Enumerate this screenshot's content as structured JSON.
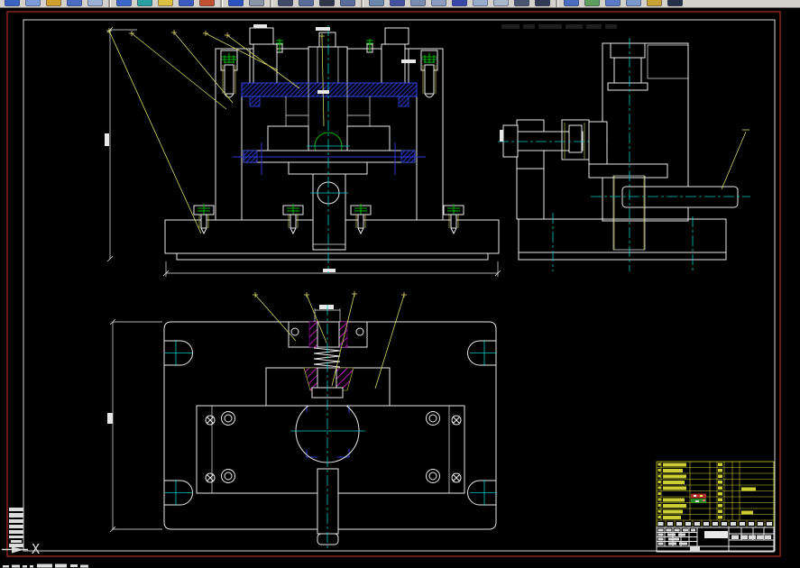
{
  "toolbar": {
    "bg_color": "#d5d2cb",
    "icons": [
      {
        "name": "toolbar-icon-1",
        "color": "#3a62c0"
      },
      {
        "name": "toolbar-icon-2",
        "color": "#7d9bd6"
      },
      {
        "name": "toolbar-icon-3",
        "color": "#d1a02c"
      },
      {
        "name": "toolbar-icon-4",
        "color": "#4a6cc4"
      },
      {
        "name": "toolbar-icon-5",
        "color": "#9db3d6"
      },
      {
        "name": "toolbar-icon-6",
        "color": "#3a66c8",
        "sep_before": true
      },
      {
        "name": "toolbar-icon-7",
        "color": "#2aa0a0"
      },
      {
        "name": "toolbar-icon-8",
        "color": "#ddc040"
      },
      {
        "name": "toolbar-icon-9",
        "color": "#3a5cc0"
      },
      {
        "name": "toolbar-icon-10",
        "color": "#c05030"
      },
      {
        "name": "toolbar-icon-11",
        "color": "#2a52c0",
        "sep_before": true
      },
      {
        "name": "toolbar-icon-12",
        "color": "#8a96a8"
      },
      {
        "name": "toolbar-icon-13",
        "color": "#404a66",
        "sep_before": true
      },
      {
        "name": "toolbar-icon-14",
        "color": "#5a6a9a"
      },
      {
        "name": "toolbar-icon-15",
        "color": "#30364a"
      },
      {
        "name": "toolbar-icon-16",
        "color": "#5a6a9a"
      },
      {
        "name": "toolbar-icon-17",
        "color": "#6a88aa",
        "sep_before": true
      },
      {
        "name": "toolbar-icon-18",
        "color": "#44519e"
      },
      {
        "name": "toolbar-icon-19",
        "color": "#7a8cae"
      },
      {
        "name": "toolbar-icon-20",
        "color": "#8b9cc0"
      },
      {
        "name": "toolbar-icon-21",
        "color": "#3947a8"
      },
      {
        "name": "toolbar-icon-22",
        "color": "#9aaccc"
      },
      {
        "name": "toolbar-icon-23",
        "color": "#aab8cc"
      },
      {
        "name": "toolbar-icon-24",
        "color": "#4a5670"
      },
      {
        "name": "toolbar-icon-25",
        "color": "#303a52"
      },
      {
        "name": "toolbar-icon-26",
        "color": "#4a6cc0",
        "sep_before": true
      },
      {
        "name": "toolbar-icon-27",
        "color": "#5e9e5e"
      },
      {
        "name": "toolbar-icon-28",
        "color": "#5a7ac8"
      },
      {
        "name": "toolbar-icon-29",
        "color": "#7b97cc"
      },
      {
        "name": "toolbar-icon-30",
        "color": "#c8a233"
      },
      {
        "name": "toolbar-icon-31",
        "color": "#24304a"
      }
    ]
  },
  "ucs": {
    "x_label": "X"
  },
  "sheet": {
    "border_color": "#9e2a22",
    "frame_color": "#d9d9d9"
  },
  "palette": {
    "outline_white": "#e8e8e8",
    "centerline_cyan": "#00c8c8",
    "hatch_magenta": "#b816b8",
    "aux_green": "#00b400",
    "leader_yellow": "#d6d66a",
    "template_blue": "#2a3ad0",
    "bom_yellow": "#cccc33"
  }
}
